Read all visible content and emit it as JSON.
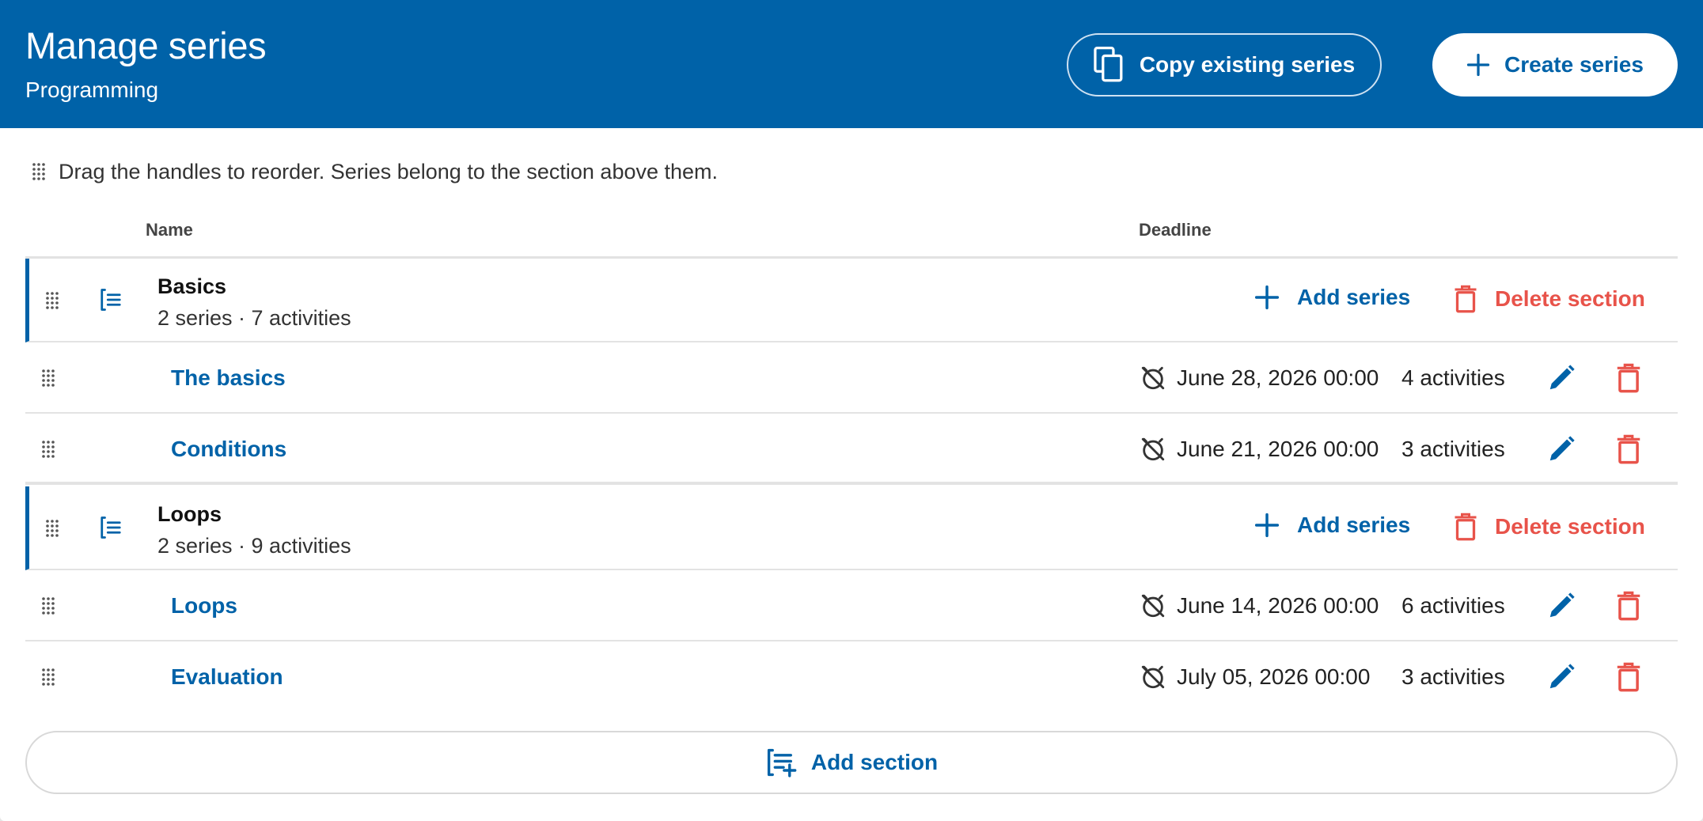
{
  "header": {
    "title": "Manage series",
    "subtitle": "Programming",
    "copy_button": "Copy existing series",
    "create_button": "Create series"
  },
  "hint": "Drag the handles to reorder. Series belong to the section above them.",
  "table": {
    "col_name": "Name",
    "col_deadline": "Deadline"
  },
  "sections": [
    {
      "name": "Basics",
      "meta": "2 series · 7 activities",
      "add_label": "Add series",
      "delete_label": "Delete section",
      "series": [
        {
          "name": "The basics",
          "deadline": "June 28, 2026 00:00",
          "activities": "4 activities"
        },
        {
          "name": "Conditions",
          "deadline": "June 21, 2026 00:00",
          "activities": "3 activities"
        }
      ]
    },
    {
      "name": "Loops",
      "meta": "2 series · 9 activities",
      "add_label": "Add series",
      "delete_label": "Delete section",
      "series": [
        {
          "name": "Loops",
          "deadline": "June 14, 2026 00:00",
          "activities": "6 activities"
        },
        {
          "name": "Evaluation",
          "deadline": "July 05, 2026 00:00",
          "activities": "3 activities"
        }
      ]
    }
  ],
  "add_section_label": "Add section",
  "colors": {
    "primary": "#0062a8",
    "danger": "#e8534a",
    "header_bg": "#0062a8"
  }
}
